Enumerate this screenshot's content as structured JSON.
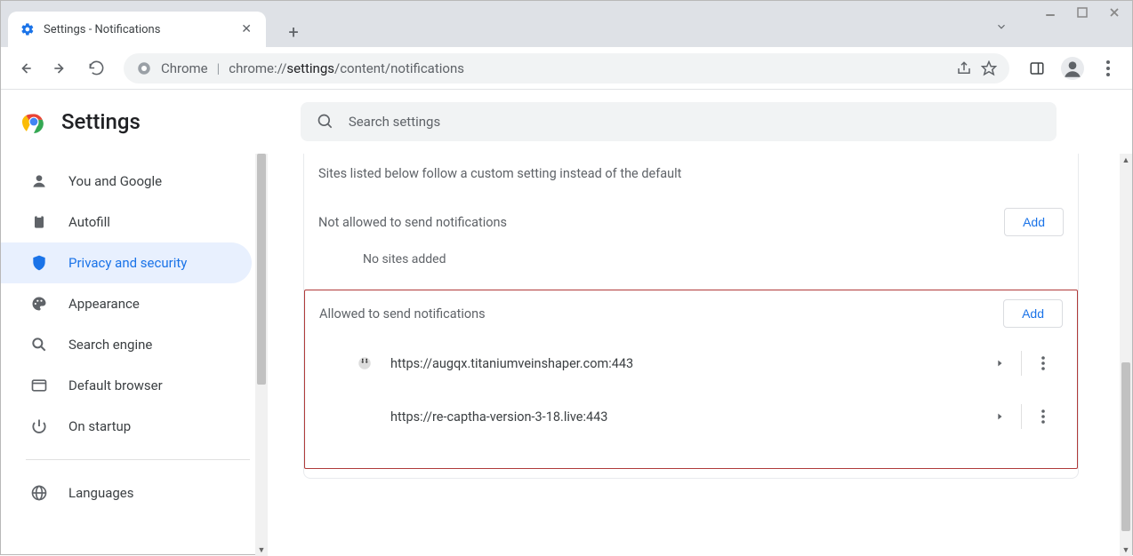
{
  "window": {
    "tab_title": "Settings - Notifications"
  },
  "omnibox": {
    "origin_label": "Chrome",
    "url_prefix": "chrome://",
    "url_mid": "settings",
    "url_suffix": "/content/notifications"
  },
  "header": {
    "title": "Settings",
    "search_placeholder": "Search settings"
  },
  "sidebar": {
    "items": [
      {
        "icon": "person",
        "label": "You and Google"
      },
      {
        "icon": "clipboard",
        "label": "Autofill"
      },
      {
        "icon": "shield",
        "label": "Privacy and security",
        "active": true
      },
      {
        "icon": "palette",
        "label": "Appearance"
      },
      {
        "icon": "search",
        "label": "Search engine"
      },
      {
        "icon": "browser",
        "label": "Default browser"
      },
      {
        "icon": "power",
        "label": "On startup"
      }
    ],
    "secondary": [
      {
        "icon": "globe",
        "label": "Languages"
      }
    ]
  },
  "main": {
    "custom_desc": "Sites listed below follow a custom setting instead of the default",
    "not_allowed_label": "Not allowed to send notifications",
    "not_allowed_add": "Add",
    "not_allowed_empty": "No sites added",
    "allowed_label": "Allowed to send notifications",
    "allowed_add": "Add",
    "allowed_sites": [
      {
        "url": "https://augqx.titaniumveinshaper.com:443",
        "has_favicon": true
      },
      {
        "url": "https://re-captha-version-3-18.live:443",
        "has_favicon": false
      }
    ]
  }
}
